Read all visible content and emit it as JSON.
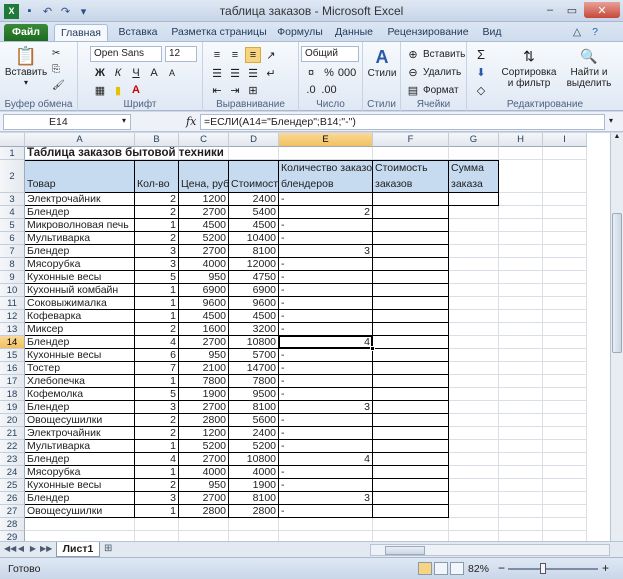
{
  "window": {
    "title": "таблица заказов - Microsoft Excel",
    "minimize": "–",
    "restore": "▭",
    "close": "✕"
  },
  "tabs": [
    "Файл",
    "Главная",
    "Вставка",
    "Разметка страницы",
    "Формулы",
    "Данные",
    "Рецензирование",
    "Вид"
  ],
  "ribbon": {
    "clipboard": {
      "label": "Буфер обмена",
      "paste": "Вставить"
    },
    "font": {
      "label": "Шрифт",
      "name": "Open Sans",
      "size": "12",
      "bold": "Ж",
      "italic": "К",
      "underline": "Ч"
    },
    "alignment": {
      "label": "Выравнивание"
    },
    "number": {
      "label": "Число",
      "format": "Общий"
    },
    "styles": {
      "label": "Стили",
      "button": "Стили"
    },
    "cells": {
      "label": "Ячейки",
      "insert": "Вставить",
      "delete": "Удалить",
      "format": "Формат"
    },
    "editing": {
      "label": "Редактирование",
      "sort": "Сортировка и фильтр",
      "find": "Найти и выделить"
    }
  },
  "formula_bar": {
    "name_box": "E14",
    "fx": "fx",
    "formula": "=ЕСЛИ(A14=\"Блендер\";B14;\"-\")"
  },
  "columns": [
    "A",
    "B",
    "C",
    "D",
    "E",
    "F",
    "G",
    "H",
    "I"
  ],
  "rows": [
    "1",
    "2",
    "3",
    "4",
    "5",
    "6",
    "7",
    "8",
    "9",
    "10",
    "11",
    "12",
    "13",
    "14",
    "15",
    "16",
    "17",
    "18",
    "19",
    "20",
    "21",
    "22",
    "23",
    "24",
    "25",
    "26",
    "27",
    "28",
    "29"
  ],
  "sheet": {
    "title": "Таблица заказов бытовой техники",
    "headers": {
      "a": "Товар",
      "b": "Кол-во",
      "c": "Цена, руб.",
      "d": "Стоимость",
      "e1": "Количество заказов",
      "e2": "блендеров",
      "f1": "Стоимость",
      "f2": "заказов",
      "g1": "Сумма",
      "g2": "заказа"
    },
    "data": [
      [
        "Электрочайник",
        "2",
        "1200",
        "2400",
        "-"
      ],
      [
        "Блендер",
        "2",
        "2700",
        "5400",
        "2"
      ],
      [
        "Микроволновая печь",
        "1",
        "4500",
        "4500",
        "-"
      ],
      [
        "Мультиварка",
        "2",
        "5200",
        "10400",
        "-"
      ],
      [
        "Блендер",
        "3",
        "2700",
        "8100",
        "3"
      ],
      [
        "Мясорубка",
        "3",
        "4000",
        "12000",
        "-"
      ],
      [
        "Кухонные весы",
        "5",
        "950",
        "4750",
        "-"
      ],
      [
        "Кухонный комбайн",
        "1",
        "6900",
        "6900",
        "-"
      ],
      [
        "Соковыжималка",
        "1",
        "9600",
        "9600",
        "-"
      ],
      [
        "Кофеварка",
        "1",
        "4500",
        "4500",
        "-"
      ],
      [
        "Миксер",
        "2",
        "1600",
        "3200",
        "-"
      ],
      [
        "Блендер",
        "4",
        "2700",
        "10800",
        "4"
      ],
      [
        "Кухонные весы",
        "6",
        "950",
        "5700",
        "-"
      ],
      [
        "Тостер",
        "7",
        "2100",
        "14700",
        "-"
      ],
      [
        "Хлебопечка",
        "1",
        "7800",
        "7800",
        "-"
      ],
      [
        "Кофемолка",
        "5",
        "1900",
        "9500",
        "-"
      ],
      [
        "Блендер",
        "3",
        "2700",
        "8100",
        "3"
      ],
      [
        "Овощесушилки",
        "2",
        "2800",
        "5600",
        "-"
      ],
      [
        "Электрочайник",
        "2",
        "1200",
        "2400",
        "-"
      ],
      [
        "Мультиварка",
        "1",
        "5200",
        "5200",
        "-"
      ],
      [
        "Блендер",
        "4",
        "2700",
        "10800",
        "4"
      ],
      [
        "Мясорубка",
        "1",
        "4000",
        "4000",
        "-"
      ],
      [
        "Кухонные весы",
        "2",
        "950",
        "1900",
        "-"
      ],
      [
        "Блендер",
        "3",
        "2700",
        "8100",
        "3"
      ],
      [
        "Овощесушилки",
        "1",
        "2800",
        "2800",
        "-"
      ]
    ],
    "active_cell": "E14"
  },
  "sheet_tabs": {
    "nav": [
      "◀◀",
      "◀",
      "▶",
      "▶▶"
    ],
    "sheet1": "Лист1"
  },
  "status": {
    "ready": "Готово",
    "zoom": "82%",
    "zoom_minus": "−",
    "zoom_plus": "+"
  },
  "icons": [
    "save-icon",
    "undo-icon",
    "redo-icon",
    "paste-icon",
    "styles-icon",
    "sum-icon",
    "sort-filter-icon",
    "find-icon"
  ]
}
